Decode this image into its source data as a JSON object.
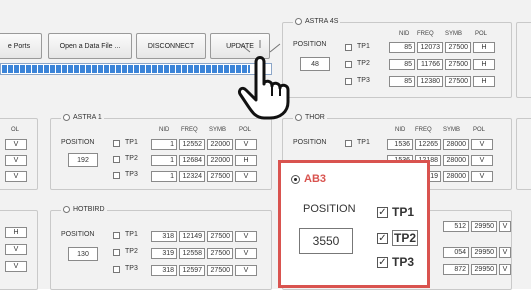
{
  "toolbar": {
    "buttons": [
      "e Ports",
      "Open a Data File ...",
      "DISCONNECT",
      "UPDATE"
    ]
  },
  "progress": {
    "value_fraction": 0.92
  },
  "table_headers": {
    "nid": "NID",
    "freq": "FREQ",
    "symb": "SYMB",
    "pol": "POL"
  },
  "position_label": "POSITION",
  "astra4s": {
    "title": "ASTRA 4S",
    "position": "48",
    "rows": [
      {
        "tp": "TP1",
        "nid": "85",
        "freq": "12073",
        "symb": "27500",
        "pol": "H"
      },
      {
        "tp": "TP2",
        "nid": "85",
        "freq": "11766",
        "symb": "27500",
        "pol": "H"
      },
      {
        "tp": "TP3",
        "nid": "85",
        "freq": "12380",
        "symb": "27500",
        "pol": "H"
      }
    ]
  },
  "astra1": {
    "title": "ASTRA 1",
    "position": "192",
    "rows": [
      {
        "tp": "TP1",
        "nid": "1",
        "freq": "12552",
        "symb": "22000",
        "pol": "V"
      },
      {
        "tp": "TP2",
        "nid": "1",
        "freq": "12684",
        "symb": "22000",
        "pol": "H"
      },
      {
        "tp": "TP3",
        "nid": "1",
        "freq": "12324",
        "symb": "27500",
        "pol": "V"
      }
    ]
  },
  "thor": {
    "title": "THOR",
    "rows": [
      {
        "tp": "TP1",
        "nid": "1536",
        "freq": "12265",
        "symb": "28000",
        "pol": "V"
      },
      {
        "tp": "TP2",
        "nid": "1536",
        "freq": "12188",
        "symb": "28000",
        "pol": "V"
      },
      {
        "tp": "TP3",
        "nid": "1536",
        "freq": "11219",
        "symb": "28000",
        "pol": "V"
      }
    ]
  },
  "hotbird": {
    "title": "HOTBIRD",
    "position": "130",
    "rows": [
      {
        "tp": "TP1",
        "nid": "318",
        "freq": "12149",
        "symb": "27500",
        "pol": "V"
      },
      {
        "tp": "TP2",
        "nid": "319",
        "freq": "12558",
        "symb": "27500",
        "pol": "V"
      },
      {
        "tp": "TP3",
        "nid": "318",
        "freq": "12597",
        "symb": "27500",
        "pol": "V"
      }
    ]
  },
  "right_partial": {
    "rows": [
      {
        "nid": "512",
        "freq": "29950",
        "pol": "V"
      },
      {
        "nid": "054",
        "freq": "29950",
        "pol": "V"
      },
      {
        "nid": "872",
        "freq": "29950",
        "pol": "V"
      }
    ]
  },
  "left_partial": {
    "col_header": "OL",
    "rows_top": [
      "V",
      "V",
      "V"
    ],
    "rows_bottom": [
      "H",
      "V",
      "V"
    ]
  },
  "ab3": {
    "title": "AB3",
    "position_label": "POSITION",
    "position": "3550",
    "tps": [
      "TP1",
      "TP2",
      "TP3"
    ]
  },
  "colors": {
    "highlight": "#d9534f",
    "progress": "#3b84d8"
  }
}
